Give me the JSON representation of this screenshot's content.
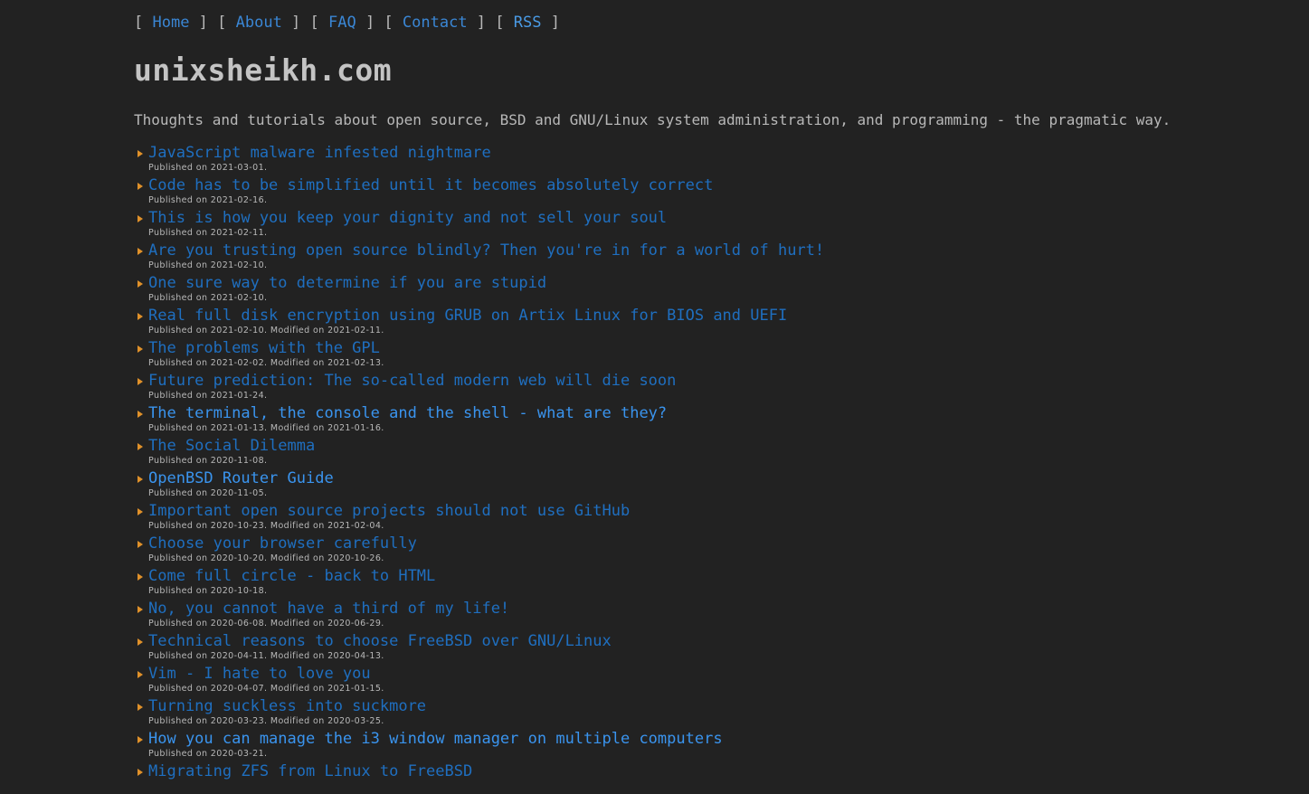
{
  "nav": {
    "items": [
      {
        "label": "Home"
      },
      {
        "label": "About"
      },
      {
        "label": "FAQ"
      },
      {
        "label": "Contact"
      },
      {
        "label": "RSS"
      }
    ]
  },
  "site": {
    "title": "unixsheikh.com",
    "tagline": "Thoughts and tutorials about open source, BSD and GNU/Linux system administration, and programming - the pragmatic way."
  },
  "colors": {
    "background": "#222222",
    "link": "#1f6fc0",
    "link_visited_bright": "#3a94ee",
    "bullet": "#e0912a",
    "text": "#b8b8b8"
  },
  "posts": [
    {
      "title": "JavaScript malware infested nightmare",
      "meta": "Published on 2021-03-01.",
      "bright": false
    },
    {
      "title": "Code has to be simplified until it becomes absolutely correct",
      "meta": "Published on 2021-02-16.",
      "bright": false
    },
    {
      "title": "This is how you keep your dignity and not sell your soul",
      "meta": "Published on 2021-02-11.",
      "bright": false
    },
    {
      "title": "Are you trusting open source blindly? Then you're in for a world of hurt!",
      "meta": "Published on 2021-02-10.",
      "bright": false
    },
    {
      "title": "One sure way to determine if you are stupid",
      "meta": "Published on 2021-02-10.",
      "bright": false
    },
    {
      "title": "Real full disk encryption using GRUB on Artix Linux for BIOS and UEFI",
      "meta": "Published on 2021-02-10. Modified on 2021-02-11.",
      "bright": false
    },
    {
      "title": "The problems with the GPL",
      "meta": "Published on 2021-02-02. Modified on 2021-02-13.",
      "bright": false
    },
    {
      "title": "Future prediction: The so-called modern web will die soon",
      "meta": "Published on 2021-01-24.",
      "bright": false
    },
    {
      "title": "The terminal, the console and the shell - what are they?",
      "meta": "Published on 2021-01-13. Modified on 2021-01-16.",
      "bright": true
    },
    {
      "title": "The Social Dilemma",
      "meta": "Published on 2020-11-08.",
      "bright": false
    },
    {
      "title": "OpenBSD Router Guide",
      "meta": "Published on 2020-11-05.",
      "bright": true
    },
    {
      "title": "Important open source projects should not use GitHub",
      "meta": "Published on 2020-10-23. Modified on 2021-02-04.",
      "bright": false
    },
    {
      "title": "Choose your browser carefully",
      "meta": "Published on 2020-10-20. Modified on 2020-10-26.",
      "bright": false
    },
    {
      "title": "Come full circle - back to HTML",
      "meta": "Published on 2020-10-18.",
      "bright": false
    },
    {
      "title": "No, you cannot have a third of my life!",
      "meta": "Published on 2020-06-08. Modified on 2020-06-29.",
      "bright": false
    },
    {
      "title": "Technical reasons to choose FreeBSD over GNU/Linux",
      "meta": "Published on 2020-04-11. Modified on 2020-04-13.",
      "bright": false
    },
    {
      "title": "Vim - I hate to love you",
      "meta": "Published on 2020-04-07. Modified on 2021-01-15.",
      "bright": false
    },
    {
      "title": "Turning suckless into suckmore",
      "meta": "Published on 2020-03-23. Modified on 2020-03-25.",
      "bright": false
    },
    {
      "title": "How you can manage the i3 window manager on multiple computers",
      "meta": "Published on 2020-03-21.",
      "bright": true
    },
    {
      "title": "Migrating ZFS from Linux to FreeBSD",
      "meta": "",
      "bright": false
    }
  ]
}
